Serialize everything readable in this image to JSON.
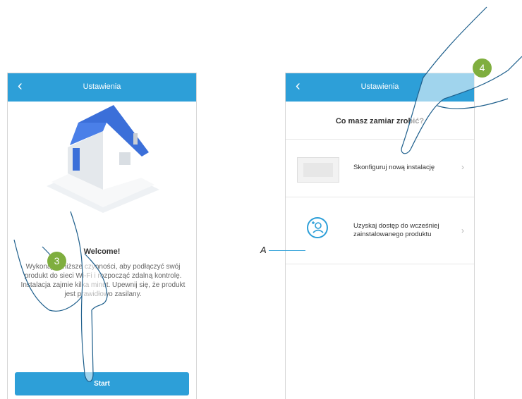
{
  "left_screen": {
    "header_title": "Ustawienia",
    "welcome_title": "Welcome!",
    "welcome_text": "Wykonaj poniższe czynności, aby podłączyć swój produkt do sieci Wi-Fi i rozpocząć zdalną kontrolę. Instalacja zajmie kilka minut. Upewnij się, że produkt jest prawidłowo zasilany.",
    "start_button": "Start"
  },
  "right_screen": {
    "header_title": "Ustawienia",
    "question": "Co masz zamiar zrobić?",
    "options": [
      {
        "label": "Skonfiguruj nową instalację",
        "icon": "thermostat-icon"
      },
      {
        "label": "Uzyskaj dostęp do wcześniej zainstalowanego produktu",
        "icon": "add-user-icon"
      }
    ]
  },
  "annotations": {
    "step_3": "3",
    "step_4": "4",
    "label_a": "A"
  },
  "colors": {
    "header_blue": "#2d9fd8",
    "step_badge_green": "#7fae3e"
  }
}
